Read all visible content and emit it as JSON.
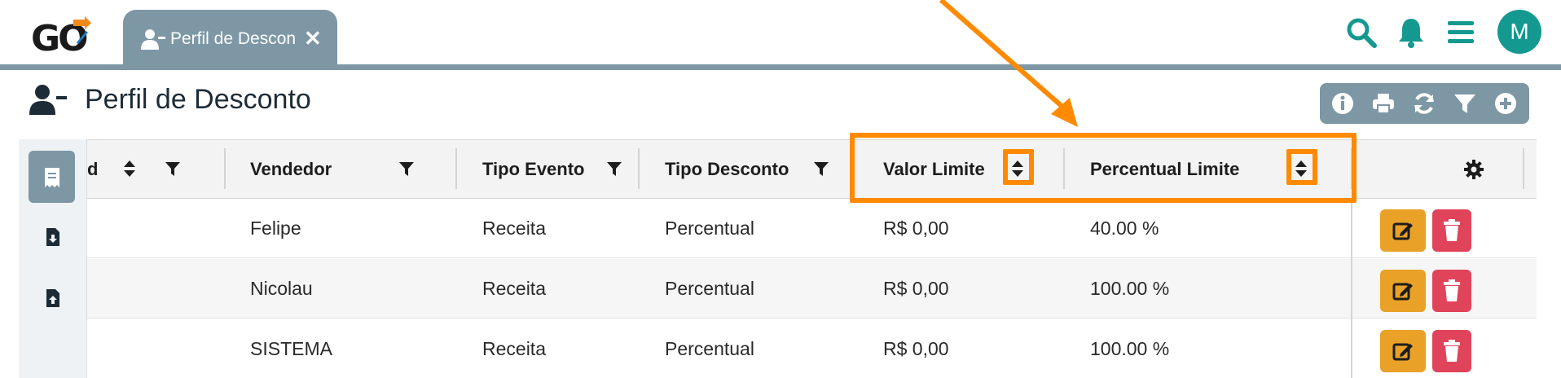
{
  "app": {
    "logo_text": "GO"
  },
  "tab": {
    "label": "Perfil de Descon",
    "close_glyph": "✕"
  },
  "nav": {
    "icons": [
      "search-icon",
      "bell-icon",
      "menu-icon"
    ],
    "avatar_initial": "M",
    "accent_color": "#13998f"
  },
  "page": {
    "title": "Perfil de Desconto"
  },
  "toolbar": {
    "icons": [
      "info-icon",
      "print-icon",
      "refresh-icon",
      "filter-icon",
      "add-icon"
    ]
  },
  "rail": {
    "icons": [
      "receipt-icon",
      "download-file-icon",
      "upload-file-icon"
    ]
  },
  "table": {
    "columns": [
      {
        "label": "d"
      },
      {
        "label": "Vendedor"
      },
      {
        "label": "Tipo Evento"
      },
      {
        "label": "Tipo Desconto"
      },
      {
        "label": "Valor Limite"
      },
      {
        "label": "Percentual Limite"
      }
    ],
    "rows": [
      {
        "vendedor": "Felipe",
        "tipo_evento": "Receita",
        "tipo_desconto": "Percentual",
        "valor_limite": "R$ 0,00",
        "percentual_limite": "40.00 %"
      },
      {
        "vendedor": "Nicolau",
        "tipo_evento": "Receita",
        "tipo_desconto": "Percentual",
        "valor_limite": "R$ 0,00",
        "percentual_limite": "100.00 %"
      },
      {
        "vendedor": "SISTEMA",
        "tipo_evento": "Receita",
        "tipo_desconto": "Percentual",
        "valor_limite": "R$ 0,00",
        "percentual_limite": "100.00 %"
      }
    ]
  },
  "colors": {
    "tab_bg": "#7d97a5",
    "edit": "#e9a227",
    "delete": "#e0445b",
    "highlight": "#ff8a00"
  }
}
